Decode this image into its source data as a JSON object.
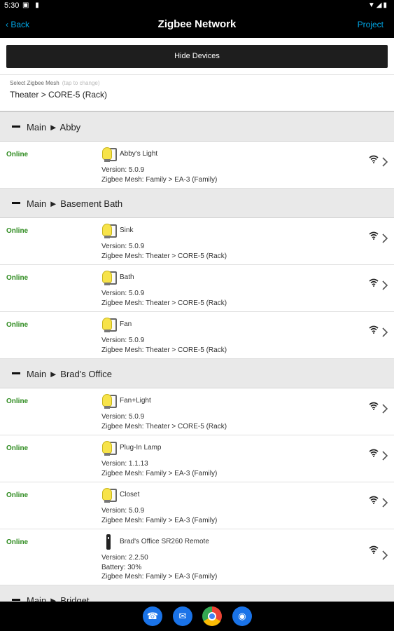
{
  "statusbar": {
    "time": "5:30",
    "left_icons": "▣ ▮",
    "right_icons": "▼◢▮"
  },
  "nav": {
    "back_label": "‹  Back",
    "title": "Zigbee Network",
    "project_label": "Project"
  },
  "hide_button": "Hide Devices",
  "mesh": {
    "label": "Select Zigbee Mesh",
    "hint": "(tap to change)",
    "value": "Theater > CORE-5 (Rack)"
  },
  "sections": [
    {
      "title": "Main ► Abby",
      "devices": [
        {
          "status": "Online",
          "icon": "light-bulb-switch",
          "name": "Abby's Light",
          "lines": [
            "Version: 5.0.9",
            "Zigbee Mesh: Family > EA-3 (Family)"
          ]
        }
      ]
    },
    {
      "title": "Main ► Basement Bath",
      "devices": [
        {
          "status": "Online",
          "icon": "light-bulb-switch",
          "name": "Sink",
          "lines": [
            "Version: 5.0.9",
            "Zigbee Mesh: Theater > CORE-5 (Rack)"
          ]
        },
        {
          "status": "Online",
          "icon": "light-bulb-switch",
          "name": "Bath",
          "lines": [
            "Version: 5.0.9",
            "Zigbee Mesh: Theater > CORE-5 (Rack)"
          ]
        },
        {
          "status": "Online",
          "icon": "light-bulb-switch",
          "name": "Fan",
          "lines": [
            "Version: 5.0.9",
            "Zigbee Mesh: Theater > CORE-5 (Rack)"
          ]
        }
      ]
    },
    {
      "title": "Main ► Brad's Office",
      "devices": [
        {
          "status": "Online",
          "icon": "light-bulb-switch",
          "name": "Fan+Light",
          "lines": [
            "Version: 5.0.9",
            "Zigbee Mesh: Theater > CORE-5 (Rack)"
          ]
        },
        {
          "status": "Online",
          "icon": "light-bulb-switch",
          "name": "Plug-In Lamp",
          "lines": [
            "Version: 1.1.13",
            "Zigbee Mesh: Family > EA-3 (Family)"
          ]
        },
        {
          "status": "Online",
          "icon": "light-bulb-switch",
          "name": "Closet",
          "lines": [
            "Version: 5.0.9",
            "Zigbee Mesh: Family > EA-3 (Family)"
          ]
        },
        {
          "status": "Online",
          "icon": "remote",
          "name": "Brad's Office SR260 Remote",
          "lines": [
            "Version: 2.2.50",
            "Battery: 30%",
            "Zigbee Mesh: Family > EA-3 (Family)"
          ]
        }
      ]
    },
    {
      "title": "Main ► Bridget",
      "devices": []
    }
  ],
  "bottom_apps": [
    {
      "name": "phone",
      "glyph": "☎"
    },
    {
      "name": "messages",
      "glyph": "✉"
    },
    {
      "name": "chrome",
      "glyph": ""
    },
    {
      "name": "camera",
      "glyph": "◉"
    }
  ],
  "colors": {
    "online": "#2e8b1f",
    "link": "#00a8e8",
    "header_bg": "#000000"
  }
}
